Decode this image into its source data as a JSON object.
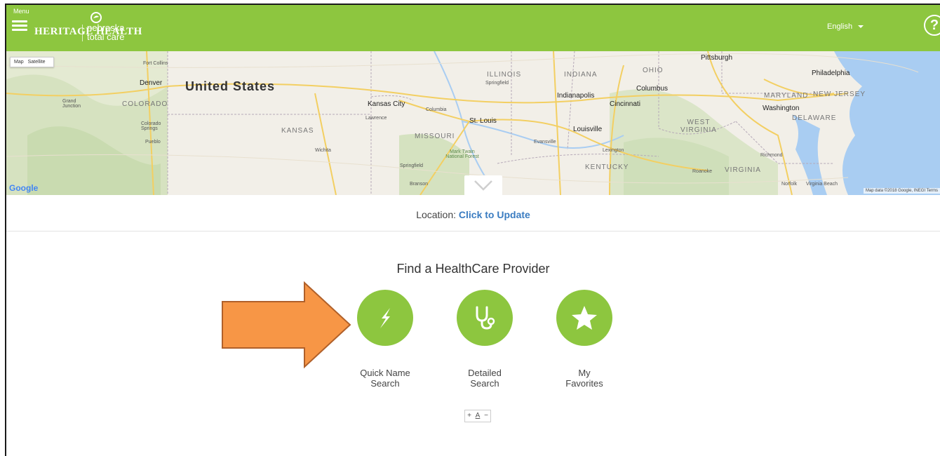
{
  "header": {
    "menu_label": "Menu",
    "logo_heritage": "HERITAGE HEALTH",
    "logo_line1": "nebraska",
    "logo_line2": "total care",
    "language": "English",
    "help_glyph": "?",
    "brand_color": "#8dc63f"
  },
  "map": {
    "toggle_map": "Map",
    "toggle_satellite": "Satellite",
    "country": "United States",
    "google": "Google",
    "attribution": "Map data ©2018 Google, INEGI  Terms",
    "labels": {
      "fort_collins": "Fort Collins",
      "denver": "Denver",
      "colorado": "COLORADO",
      "grand_junction": "Grand Junction",
      "colorado_springs": "Colorado Springs",
      "pueblo": "Pueblo",
      "kansas": "KANSAS",
      "wichita": "Wichita",
      "kansas_city": "Kansas City",
      "lawrence": "Lawrence",
      "columbia": "Columbia",
      "missouri": "MISSOURI",
      "springfield_mo": "Springfield",
      "branson": "Branson",
      "mark_twain": "Mark Twain National Forest",
      "st_louis": "St. Louis",
      "illinois": "ILLINOIS",
      "springfield_il": "Springfield",
      "indiana": "INDIANA",
      "indianapolis": "Indianapolis",
      "evansville": "Evansville",
      "louisville": "Louisville",
      "lexington": "Lexington",
      "kentucky": "KENTUCKY",
      "ohio": "OHIO",
      "columbus": "Columbus",
      "cincinnati": "Cincinnati",
      "pittsburgh": "Pittsburgh",
      "west_virginia": "WEST VIRGINIA",
      "virginia": "VIRGINIA",
      "roanoke": "Roanoke",
      "richmond": "Richmond",
      "norfolk": "Norfolk",
      "virginia_beach": "Virginia Beach",
      "washington": "Washington",
      "maryland": "MARYLAND",
      "delaware": "DELAWARE",
      "new_jersey": "NEW JERSEY",
      "philadelphia": "Philadelphia"
    }
  },
  "location": {
    "prefix": "Location:",
    "link": "Click to Update"
  },
  "find": {
    "title": "Find a HealthCare Provider",
    "options": [
      {
        "line1": "Quick Name",
        "line2": "Search",
        "icon": "lightning-bolt-icon"
      },
      {
        "line1": "Detailed",
        "line2": "Search",
        "icon": "stethoscope-icon"
      },
      {
        "line1": "My",
        "line2": "Favorites",
        "icon": "star-icon"
      }
    ],
    "font_controls": {
      "increase": "+",
      "reset": "A",
      "decrease": "−"
    }
  },
  "annotation": {
    "arrow_color": "#f79646",
    "arrow_outline": "#b0602a"
  }
}
